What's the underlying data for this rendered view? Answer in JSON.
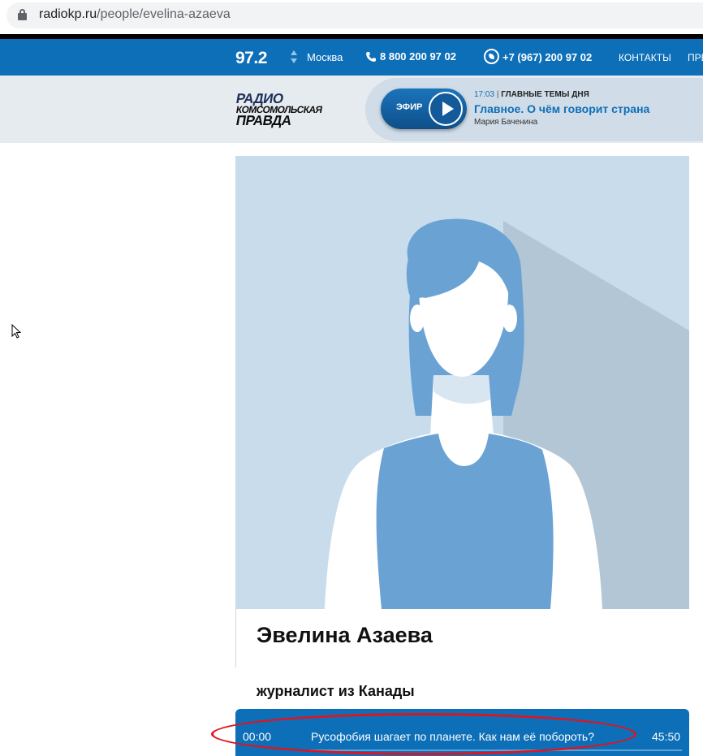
{
  "browser": {
    "url_host": "radiokp.ru",
    "url_path": "/people/evelina-azaeva",
    "lock_icon": "lock-icon"
  },
  "topnav": {
    "frequency": "97.2",
    "city": "Москва",
    "phone_main": "8 800 200 97 02",
    "phone_whatsapp": "+7 (967) 200 97 02",
    "contacts_label": "КОНТАКТЫ",
    "overflow_label": "ПРЕ",
    "bg_color": "#0d6fb8"
  },
  "logo": {
    "line1": "РАДИО",
    "line2": "КОМСОМОЛЬСКАЯ",
    "line3": "ПРАВДА"
  },
  "live": {
    "button_label": "ЭФИР",
    "time": "17:03",
    "separator": "|",
    "category": "ГЛАВНЫЕ ТЕМЫ ДНЯ",
    "title": "Главное. О чём говорит страна",
    "host": "Мария Баченина"
  },
  "person": {
    "name": "Эвелина Азаева",
    "role": "журналист из Канады"
  },
  "player": {
    "current_time": "00:00",
    "episode_title": "Русофобия шагает по планете. Как нам её побороть?",
    "duration": "45:50",
    "progress": 0
  }
}
